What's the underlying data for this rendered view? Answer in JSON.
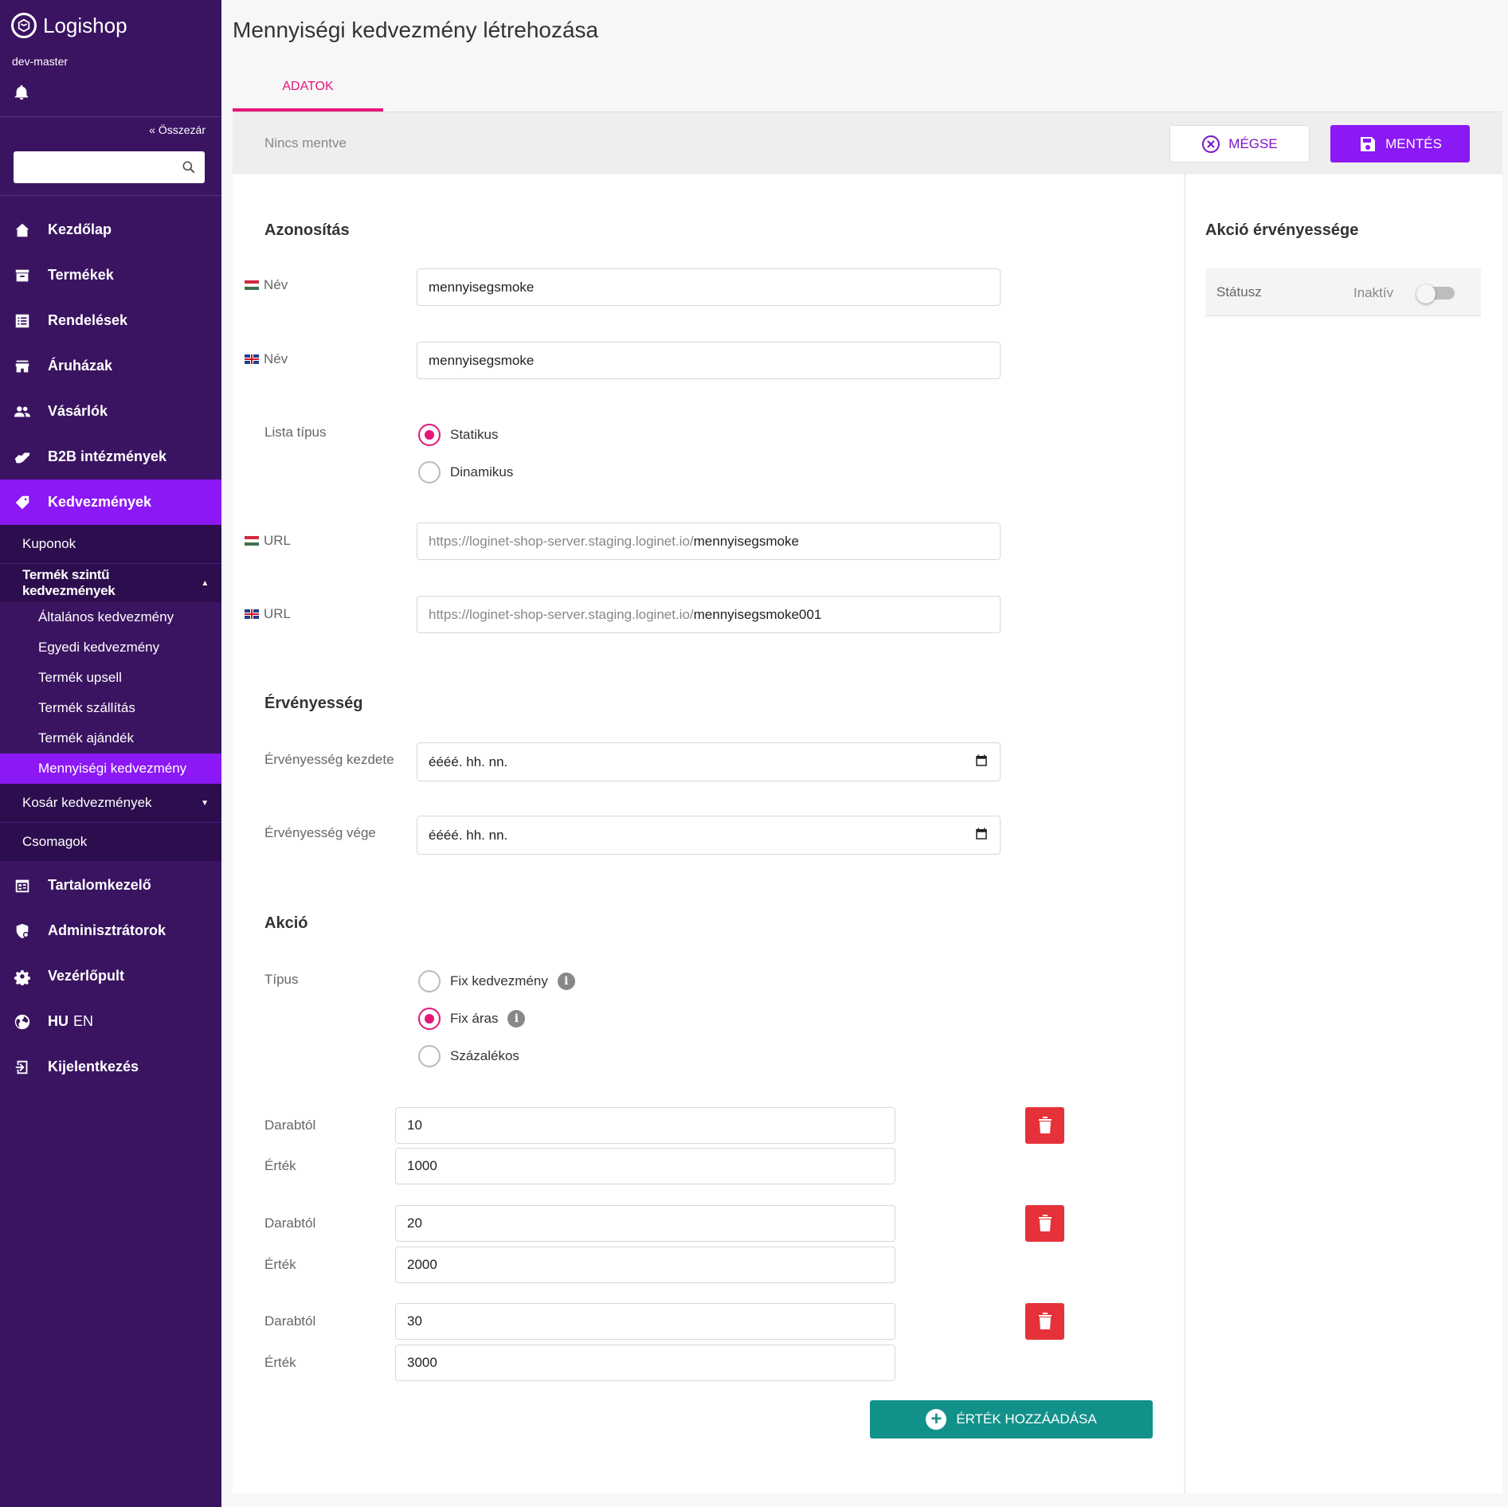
{
  "app": {
    "name": "Logishop",
    "environment": "dev-master"
  },
  "sidebar": {
    "collapse_label": "Összezár",
    "search": {
      "placeholder": "",
      "value": ""
    },
    "items": [
      {
        "label": "Kezdőlap",
        "icon": "home-icon"
      },
      {
        "label": "Termékek",
        "icon": "archive-icon"
      },
      {
        "label": "Rendelések",
        "icon": "list-icon"
      },
      {
        "label": "Áruházak",
        "icon": "store-icon"
      },
      {
        "label": "Vásárlók",
        "icon": "people-icon"
      },
      {
        "label": "B2B intézmények",
        "icon": "handshake-icon"
      },
      {
        "label": "Kedvezmények",
        "icon": "tag-icon",
        "active": true
      }
    ],
    "discount_sub": {
      "coupons": "Kuponok",
      "product_level": "Termék szintű kedvezmények",
      "product_level_children": [
        "Általános kedvezmény",
        "Egyedi kedvezmény",
        "Termék upsell",
        "Termék szállítás",
        "Termék ajándék",
        "Mennyiségi kedvezmény"
      ],
      "cart": "Kosár kedvezmények",
      "packages": "Csomagok"
    },
    "lower_items": [
      {
        "label": "Tartalomkezelő",
        "icon": "calendar-icon"
      },
      {
        "label": "Adminisztrátorok",
        "icon": "admin-shield-icon"
      },
      {
        "label": "Vezérlőpult",
        "icon": "gear-icon"
      }
    ],
    "lang": {
      "hu": "HU",
      "en": "EN"
    },
    "logout": "Kijelentkezés"
  },
  "page": {
    "title": "Mennyiségi kedvezmény létrehozása",
    "tab": "ADATOK",
    "save_status": "Nincs mentve",
    "cancel_label": "MÉGSE",
    "save_label": "MENTÉS"
  },
  "form": {
    "identification": {
      "title": "Azonosítás",
      "name_label": "Név",
      "name_hu": "mennyisegsmoke",
      "name_en": "mennyisegsmoke",
      "list_type_label": "Lista típus",
      "list_type_options": [
        "Statikus",
        "Dinamikus"
      ],
      "list_type_selected": "Statikus",
      "url_label": "URL",
      "url_prefix": "https://loginet-shop-server.staging.loginet.io/",
      "url_hu": "mennyisegsmoke",
      "url_en": "mennyisegsmoke001"
    },
    "validity": {
      "title": "Érvényesség",
      "start_label": "Érvényesség kezdete",
      "end_label": "Érvényesség vége",
      "date_placeholder": "éééé. hh. nn."
    },
    "action": {
      "title": "Akció",
      "type_label": "Típus",
      "type_options": [
        "Fix kedvezmény",
        "Fix áras",
        "Százalékos"
      ],
      "type_selected": "Fix áras",
      "from_label": "Darabtól",
      "value_label": "Érték",
      "tiers": [
        {
          "from": "10",
          "value": "1000"
        },
        {
          "from": "20",
          "value": "2000"
        },
        {
          "from": "30",
          "value": "3000"
        }
      ],
      "add_label": "ÉRTÉK HOZZÁADÁSA"
    }
  },
  "side_panel": {
    "title": "Akció érvényessége",
    "status_label": "Státusz",
    "status_value": "Inaktív",
    "status_on": false
  },
  "colors": {
    "sidebar_bg": "#3a1461",
    "accent_purple": "#8c18f5",
    "accent_pink": "#e6167a",
    "delete_red": "#e5323a",
    "add_teal": "#12918a"
  }
}
